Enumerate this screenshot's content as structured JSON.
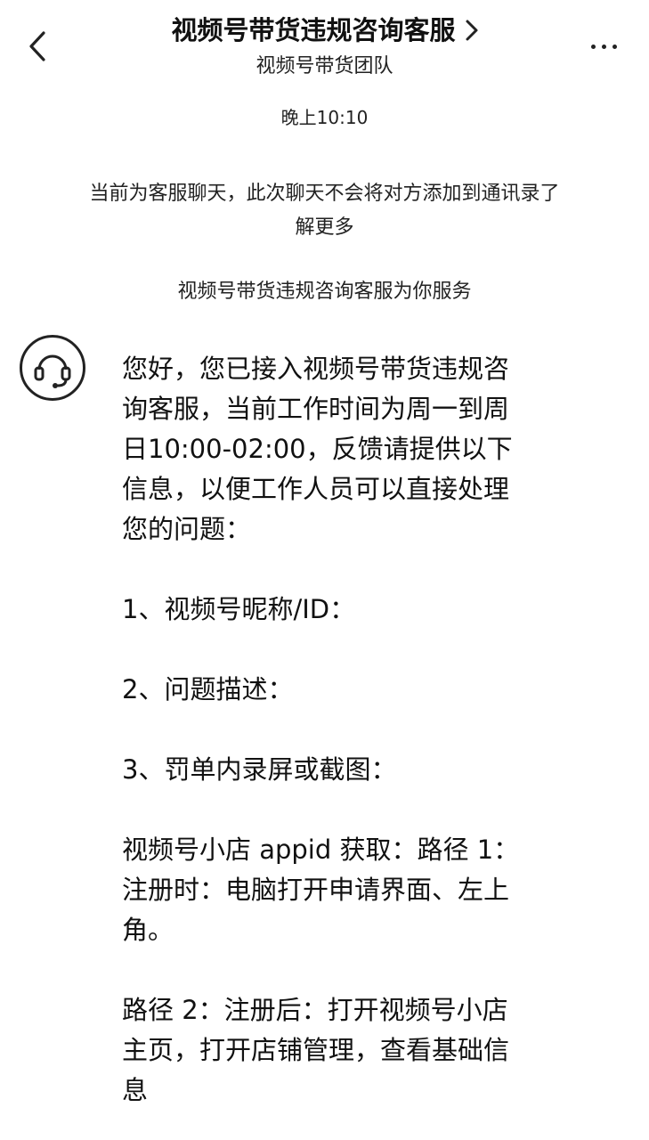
{
  "header": {
    "title": "视频号带货违规咨询客服",
    "subtitle": "视频号带货团队"
  },
  "icons": {
    "back": "chevron-left-icon",
    "title_arrow": "chevron-right-icon",
    "more": "more-horizontal-icon",
    "avatar": "headset-icon"
  },
  "chat": {
    "timestamp": "晚上10:10",
    "notice_text": "当前为客服聊天，此次聊天不会将对方添加到通讯录了",
    "notice_link": "解更多",
    "service_line": "视频号带货违规咨询客服为你服务",
    "message": {
      "lines": [
        "您好，您已接入视频号带货违规咨",
        "询客服，当前工作时间为周一到周",
        "日10:00-02:00，反馈请提供以下",
        "信息，以便工作人员可以直接处理",
        "您的问题："
      ],
      "item1": "1、视频号昵称/ID：",
      "item2": "2、问题描述：",
      "item3": "3、罚单内录屏或截图：",
      "appid_lines": [
        "视频号小店 appid 获取：路径 1：",
        "注册时：电脑打开申请界面、左上",
        "角。"
      ],
      "path2_lines": [
        "路径 2：注册后：打开视频号小店",
        "主页，打开店铺管理，查看基础信",
        "息"
      ]
    }
  }
}
